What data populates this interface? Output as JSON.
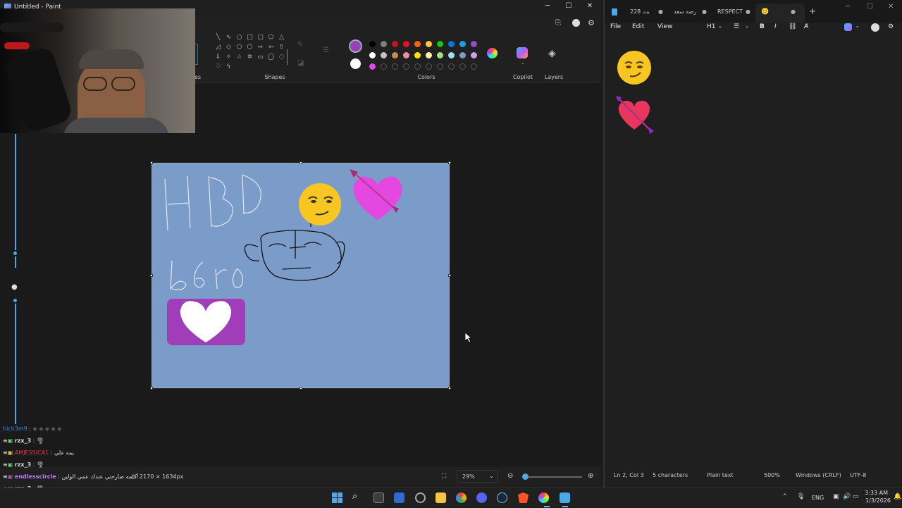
{
  "paint": {
    "title": "Untitled - Paint",
    "ribbon": {
      "images_label_fragment": "es",
      "shapes_label": "Shapes",
      "colors_label": "Colors",
      "copilot_label": "Copilot",
      "layers_label": "Layers"
    },
    "canvas_text": {
      "hbd": "HBD",
      "bro": "b6ro"
    },
    "status": {
      "canvas_size": "2170 × 1634px",
      "zoom": "29%"
    },
    "colors": {
      "active_primary": "#9b3fb5",
      "active_secondary": "#ffffff",
      "canvas_bg": "#7b9bc8",
      "palette_row1": [
        "#000000",
        "#7f7f7f",
        "#c3161c",
        "#e81123",
        "#f7630c",
        "#ffc83d",
        "#16c60c",
        "#0078d4",
        "#1a9ee0",
        "#8e4fc2"
      ],
      "palette_row2": [
        "#ffffff",
        "#c3c3c3",
        "#c88a5b",
        "#f38ba0",
        "#fce100",
        "#fff3a3",
        "#a3e27a",
        "#9fdcf5",
        "#7b9bc8",
        "#c8a2e8"
      ],
      "accent_purple": "#e448e0"
    }
  },
  "chat": {
    "messages": [
      {
        "user": "hich3m9",
        "text": ""
      },
      {
        "user": "rzx_3",
        "text": "🌪"
      },
      {
        "user": "AMJESSICA1",
        "text": "يمه علي"
      },
      {
        "user": "rzx_3",
        "text": "🌪"
      },
      {
        "user": "endlesscircle",
        "text": "أكلمه صارحني عندك عمي الولين"
      },
      {
        "user": "rzx_3",
        "text": "🌪"
      },
      {
        "user": "rzx_3",
        "text": "🌪"
      }
    ]
  },
  "notepad": {
    "tabs": [
      "228 بت",
      "رضه سعد",
      "RESPECT"
    ],
    "menu": {
      "file": "File",
      "edit": "Edit",
      "view": "View",
      "heading": "H1"
    },
    "status": {
      "position": "Ln 2, Col 3",
      "characters": "5 characters",
      "format": "Plain text",
      "zoom": "500%",
      "line_endings": "Windows (CRLF)",
      "encoding": "UTF-8"
    }
  },
  "taskbar": {
    "lang": "ENG",
    "time": "3:33 AM",
    "date": "1/3/2026"
  }
}
